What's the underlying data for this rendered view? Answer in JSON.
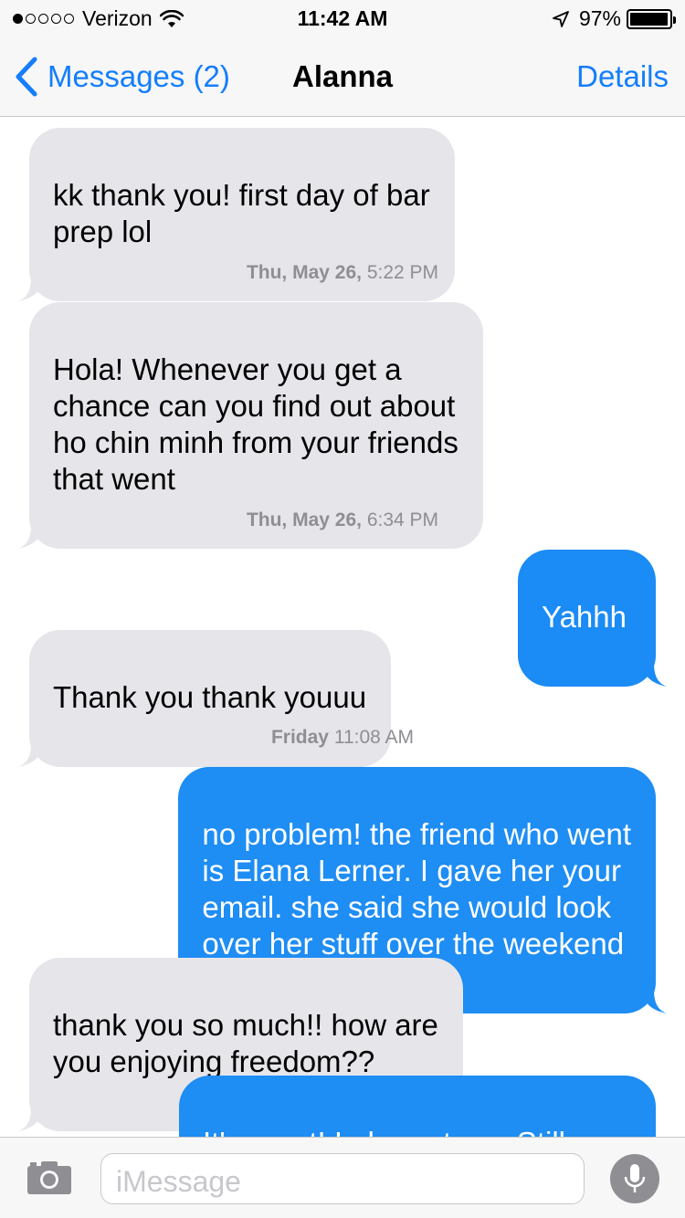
{
  "status_bar": {
    "carrier": "Verizon",
    "signal_bars_filled": 1,
    "signal_bars_total": 5,
    "time": "11:42 AM",
    "battery_percent": "97%",
    "battery_level": 0.97
  },
  "nav": {
    "back_label": "Messages (2)",
    "title": "Alanna",
    "details_label": "Details"
  },
  "messages": [
    {
      "type": "incoming",
      "text": "kk thank you! first day of bar\nprep lol"
    },
    {
      "type": "timestamp",
      "day": "Thu, May 26,",
      "time": "5:22 PM"
    },
    {
      "type": "incoming",
      "text": "Hola! Whenever you get a\nchance can you find out about\nho chin minh from your friends\nthat went"
    },
    {
      "type": "timestamp",
      "day": "Thu, May 26,",
      "time": "6:34 PM"
    },
    {
      "type": "outgoing",
      "text": "Yahhh"
    },
    {
      "type": "incoming",
      "text": "Thank you thank youuu"
    },
    {
      "type": "timestamp",
      "day": "Friday",
      "time": "11:08 AM"
    },
    {
      "type": "outgoing",
      "text": "no problem! the friend who went\nis Elana Lerner. I gave her your\nemail. she said she would look\nover her stuff over the weekend"
    },
    {
      "type": "incoming",
      "text": "thank you so much!! how are\nyou enjoying freedom??"
    },
    {
      "type": "outgoing",
      "text": "It's great! In hamptons.  Still\n"
    }
  ],
  "input": {
    "placeholder": "iMessage"
  },
  "colors": {
    "accent": "#147efb",
    "incoming_bubble": "#e5e5ea",
    "outgoing_bubble": "#1e8df4",
    "timestamp_text": "#8e8e93"
  },
  "icons": {
    "back": "chevron-left-icon",
    "wifi": "wifi-icon",
    "location": "location-arrow-icon",
    "battery": "battery-icon",
    "camera": "camera-icon",
    "microphone": "microphone-icon"
  }
}
